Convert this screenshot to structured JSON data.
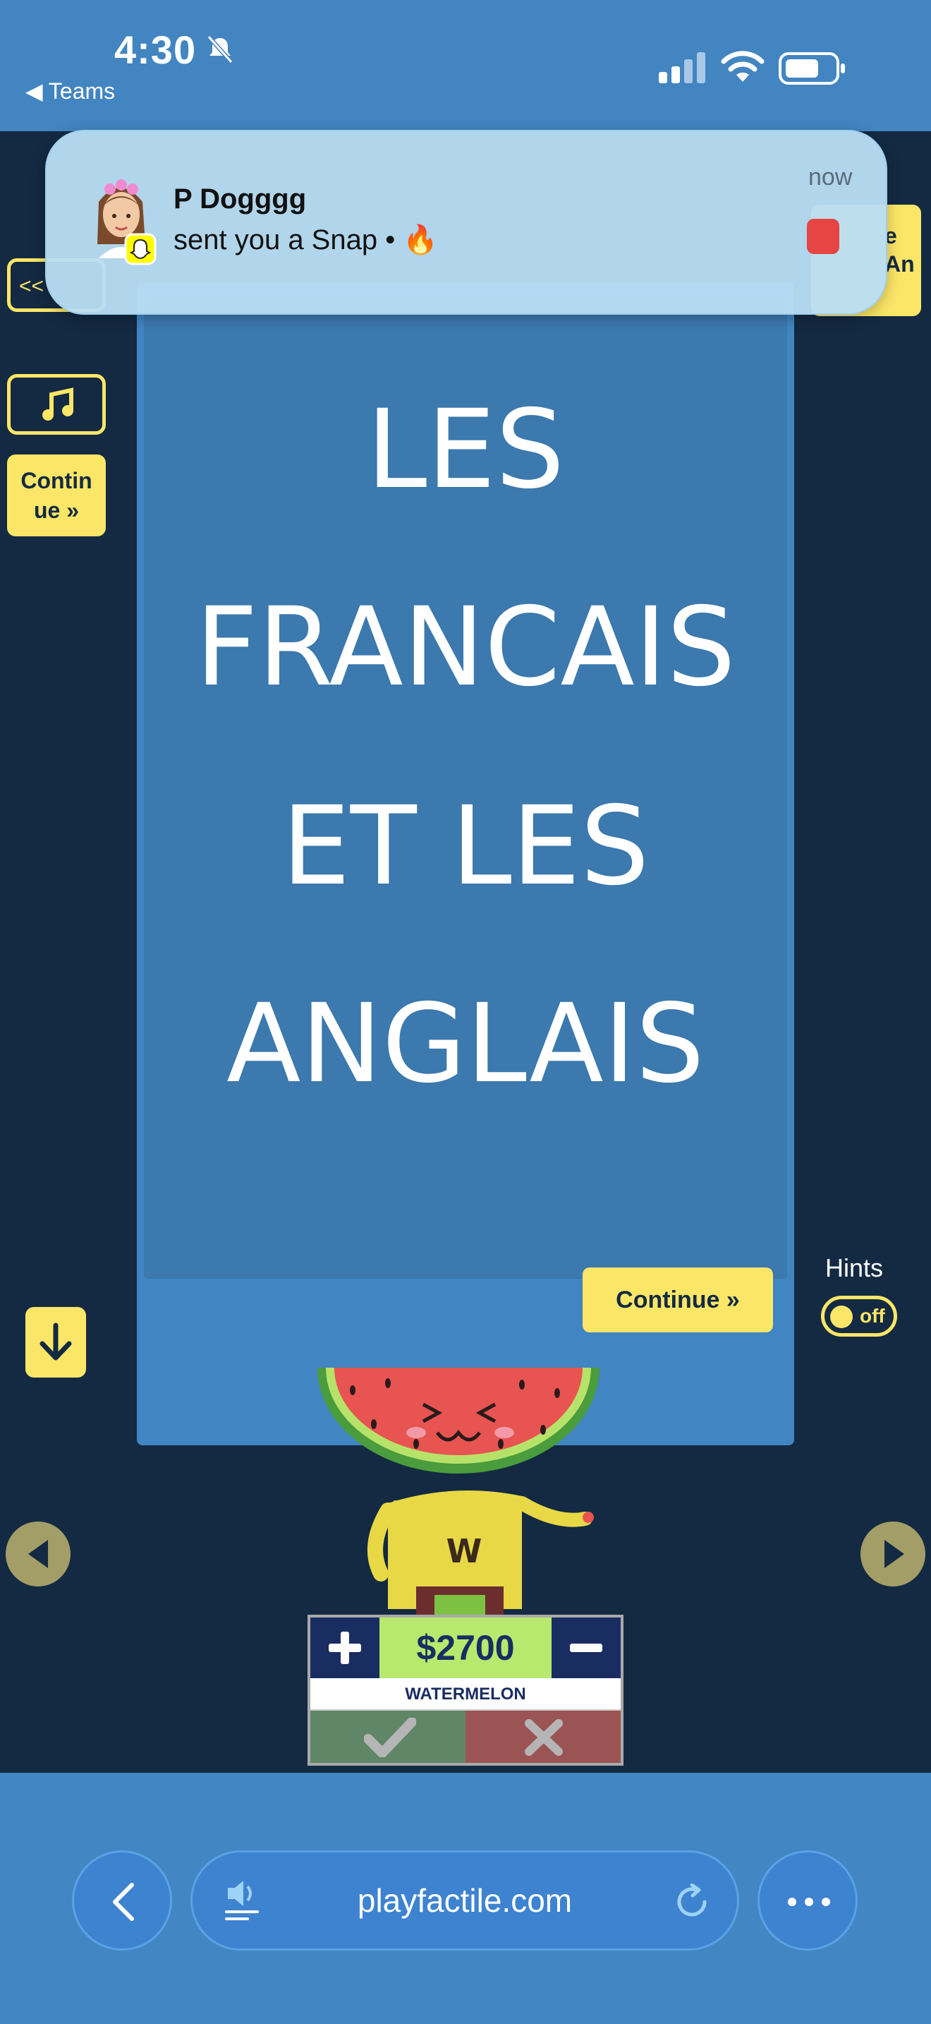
{
  "status_bar": {
    "time": "4:30",
    "back_app": "◀ Teams"
  },
  "notification": {
    "title": "P Dogggg",
    "body": "sent you a Snap • 🔥",
    "time": "now"
  },
  "sidebar": {
    "prev_label": "<< ",
    "continue_label": "Contin ue »"
  },
  "right_button_label": "e An",
  "card": {
    "lines": [
      "LES",
      "FRANCAIS",
      "ET LES",
      "ANGLAIS"
    ],
    "continue_label": "Continue »"
  },
  "hints": {
    "label": "Hints",
    "toggle_state": "off"
  },
  "player": {
    "score": "$2700",
    "name": "WATERMELON",
    "shirt_letter": "W"
  },
  "browser": {
    "url": "playfactile.com"
  },
  "colors": {
    "page_bg": "#132a42",
    "accent_yellow": "#fce667",
    "card_blue": "#3b79ae",
    "browser_blue": "#4286c4"
  }
}
